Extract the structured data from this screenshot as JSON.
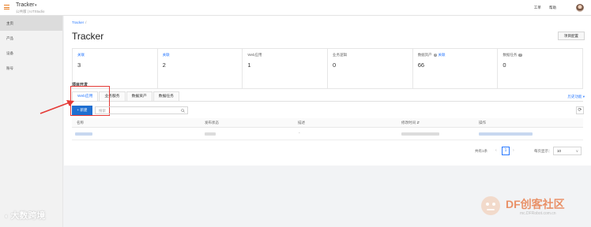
{
  "topbar": {
    "app_title": "Tracker",
    "app_caret": "▾",
    "app_subtitle": "公共版 | IoTStudio",
    "links": [
      "工单",
      "帮助"
    ]
  },
  "sidebar": {
    "items": [
      {
        "label": "主页",
        "active": true
      },
      {
        "label": "产品",
        "active": false
      },
      {
        "label": "设备",
        "active": false
      },
      {
        "label": "账号",
        "active": false
      }
    ]
  },
  "main": {
    "breadcrumb": "Tracker",
    "breadcrumb_sep": "/",
    "title": "Tracker",
    "config_button": "项目配置",
    "stats": [
      {
        "label": "",
        "link": "关联",
        "value": "3",
        "help": false
      },
      {
        "label": "",
        "link": "关联",
        "value": "2",
        "help": false
      },
      {
        "label": "Web应用",
        "link": "",
        "value": "1",
        "help": false
      },
      {
        "label": "业务逻辑",
        "link": "",
        "value": "0",
        "help": false
      },
      {
        "label": "数据资产",
        "link": "关联",
        "value": "66",
        "help": true
      },
      {
        "label": "数据任务",
        "link": "",
        "value": "0",
        "help": true
      }
    ],
    "section_title": "项目开发",
    "tabs": [
      "Web应用",
      "业务服务",
      "数据资产",
      "数据任务"
    ],
    "history_link": "历史功能 ▾",
    "new_button": "+ 新建",
    "search_placeholder": "搜索",
    "refresh_icon": "⟳",
    "table": {
      "columns": [
        "名称",
        "发布状态",
        "描述",
        "修改时间 ⇵",
        "操作"
      ],
      "rows": [
        {
          "description": "-"
        }
      ]
    },
    "pagination": {
      "total": "共有1条",
      "prev": "‹",
      "current": "1",
      "next": "›",
      "page_size_label": "每页显示：",
      "page_size": "10",
      "caret": "∨"
    }
  },
  "watermarks": {
    "left": "大数跨境",
    "brand": "DF创客社区",
    "url": "mc.DFRobot.com.cn"
  },
  "colors": {
    "accent": "#2979ff",
    "primary_button": "#1f6fd1",
    "highlight": "#e53935",
    "menu_icon": "#e77a1e"
  }
}
